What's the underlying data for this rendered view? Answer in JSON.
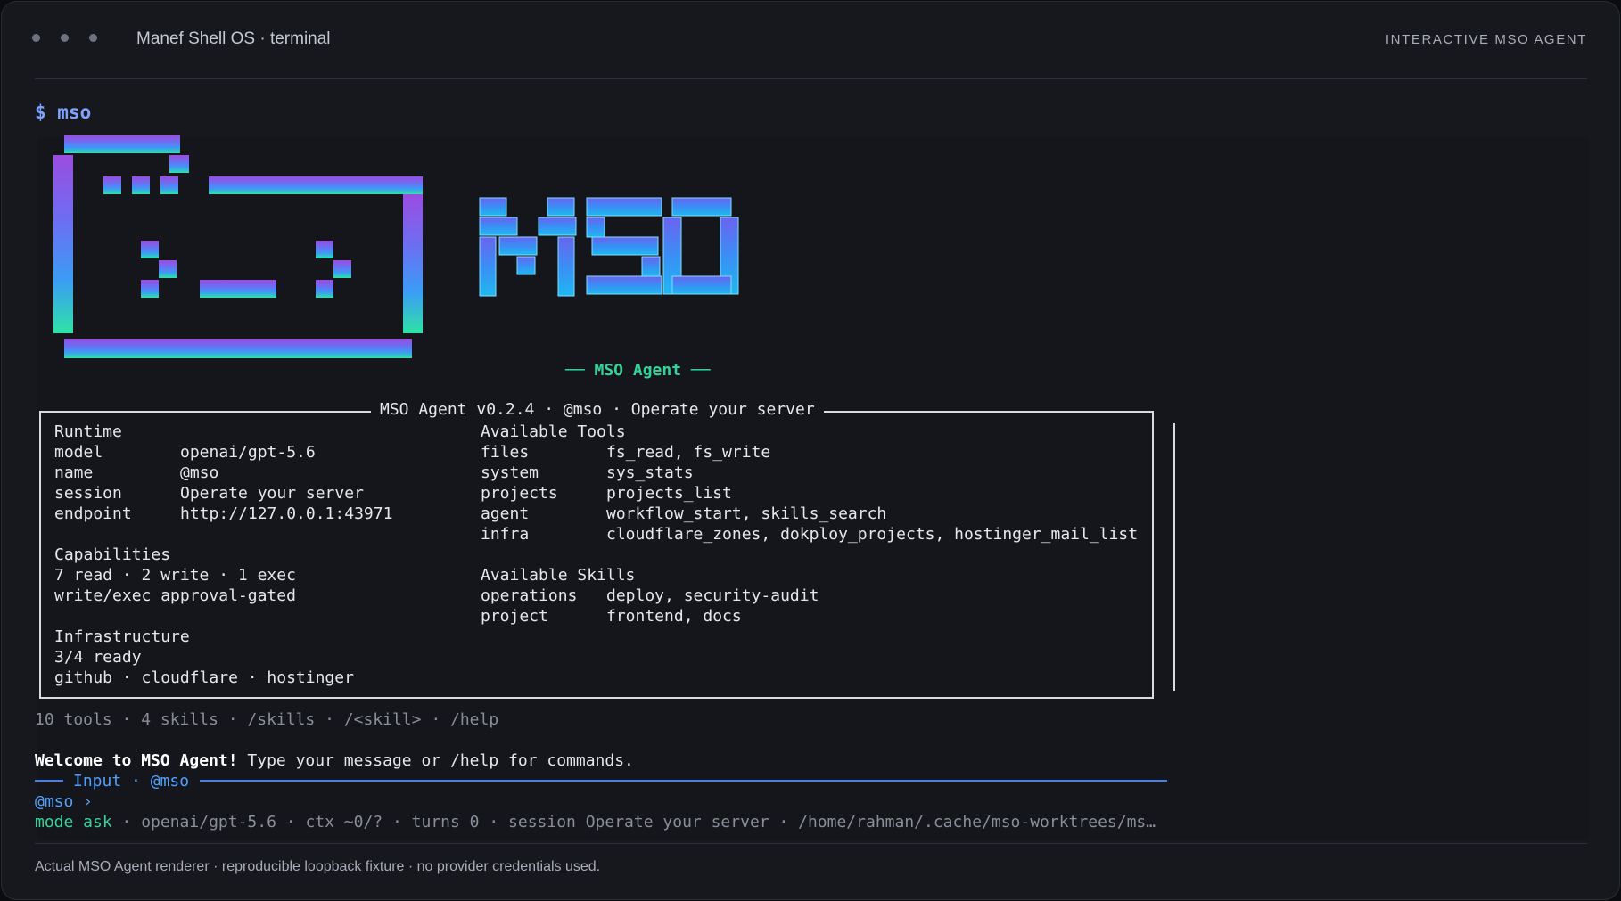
{
  "window": {
    "title": "Manef Shell OS · terminal",
    "badge": "INTERACTIVE MSO AGENT"
  },
  "prompt": {
    "command": "$ mso"
  },
  "banner": {
    "tagline": "── MSO Agent ──"
  },
  "panel": {
    "title": "MSO Agent v0.2.4 · @mso · Operate your server",
    "runtime": {
      "heading": "Runtime",
      "rows": [
        {
          "key": "model",
          "value": "openai/gpt-5.6"
        },
        {
          "key": "name",
          "value": "@mso"
        },
        {
          "key": "session",
          "value": "Operate your server"
        },
        {
          "key": "endpoint",
          "value": "http://127.0.0.1:43971"
        }
      ]
    },
    "tools": {
      "heading": "Available Tools",
      "rows": [
        {
          "key": "files",
          "value": "fs_read, fs_write"
        },
        {
          "key": "system",
          "value": "sys_stats"
        },
        {
          "key": "projects",
          "value": "projects_list"
        },
        {
          "key": "agent",
          "value": "workflow_start, skills_search"
        },
        {
          "key": "infra",
          "value": "cloudflare_zones, dokploy_projects, hostinger_mail_list"
        }
      ]
    },
    "capabilities": {
      "heading": "Capabilities",
      "lines": [
        "7 read · 2 write · 1 exec",
        "write/exec approval-gated"
      ]
    },
    "skills": {
      "heading": "Available Skills",
      "rows": [
        {
          "key": "operations",
          "value": "deploy, security-audit"
        },
        {
          "key": "project",
          "value": "frontend, docs"
        }
      ]
    },
    "infrastructure": {
      "heading": "Infrastructure",
      "lines": [
        "3/4 ready",
        "github · cloudflare · hostinger"
      ]
    }
  },
  "summary": "10 tools · 4 skills · /skills · /<skill> · /help",
  "welcome": {
    "bold": "Welcome to MSO Agent!",
    "rest": " Type your message or /help for commands."
  },
  "input": {
    "label": "Input · @mso",
    "prompt": "@mso ›"
  },
  "status": {
    "mode": "mode ask",
    "rest": " · openai/gpt-5.6 · ctx ~0/? · turns 0 · session Operate your server · /home/rahman/.cache/mso-worktrees/ms…"
  },
  "footer": "Actual MSO Agent renderer · reproducible loopback fixture · no provider credentials used.",
  "colors": {
    "accent_blue": "#4ea1ff",
    "accent_green": "#34d399",
    "logo_purple": "#8b5cf6",
    "logo_cyan": "#22d3ee"
  }
}
